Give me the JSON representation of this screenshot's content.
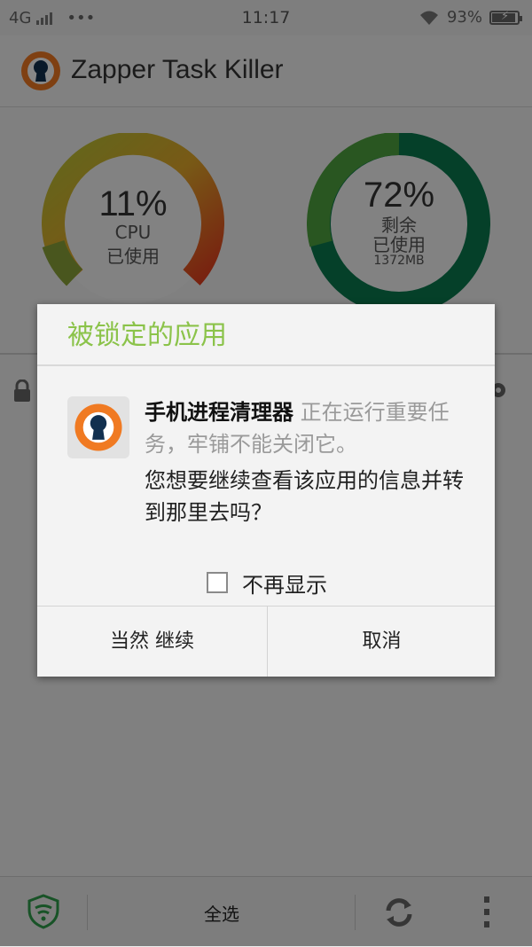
{
  "status_bar": {
    "network": "4G",
    "dots": "•••",
    "time": "11:17",
    "battery_percent": "93%"
  },
  "app": {
    "title": "Zapper Task Killer",
    "cpu_gauge": {
      "value_text": "11%",
      "label": "CPU",
      "sublabel": "已使用"
    },
    "memory_gauge": {
      "value_text": "72%",
      "label_remaining": "剩余",
      "label_used": "已使用",
      "size": "1372MB"
    }
  },
  "dialog": {
    "title": "被锁定的应用",
    "app_name": "手机进程清理器",
    "message_part": " 正在运行重要任务，牢铺不能关闭它。",
    "question": "您想要继续查看该应用的信息并转到那里去吗？",
    "checkbox_label": "不再显示",
    "checkbox_checked": false,
    "confirm_label": "当然 继续",
    "cancel_label": "取消"
  },
  "bottom_bar": {
    "select_all": "全选"
  },
  "colors": {
    "accent_green": "#8bc34a",
    "gauge_dark_green": "#0a7a4e"
  }
}
